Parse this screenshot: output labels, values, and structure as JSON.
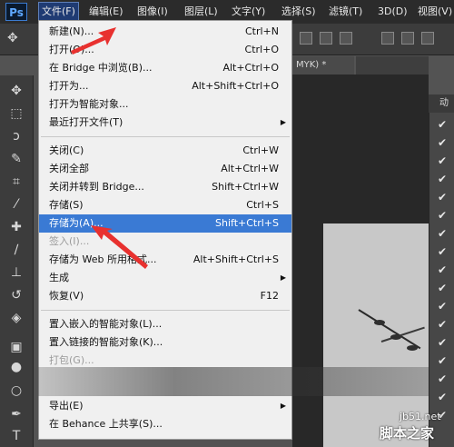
{
  "app": {
    "logo": "Ps"
  },
  "menubar": {
    "items": [
      {
        "label": "文件(F)",
        "active": true
      },
      {
        "label": "编辑(E)"
      },
      {
        "label": "图像(I)"
      },
      {
        "label": "图层(L)"
      },
      {
        "label": "文字(Y)"
      },
      {
        "label": "选择(S)"
      },
      {
        "label": "滤镜(T)"
      },
      {
        "label": "3D(D)"
      },
      {
        "label": "视图(V)"
      }
    ]
  },
  "document": {
    "tab_label": "MYK) *"
  },
  "panel": {
    "header": "动"
  },
  "file_menu": {
    "items": [
      {
        "label": "新建(N)...",
        "shortcut": "Ctrl+N"
      },
      {
        "label": "打开(O)...",
        "shortcut": "Ctrl+O"
      },
      {
        "label": "在 Bridge 中浏览(B)...",
        "shortcut": "Alt+Ctrl+O"
      },
      {
        "label": "打开为...",
        "shortcut": "Alt+Shift+Ctrl+O"
      },
      {
        "label": "打开为智能对象...",
        "shortcut": ""
      },
      {
        "label": "最近打开文件(T)",
        "shortcut": "",
        "submenu": true
      },
      {
        "label": "关闭(C)",
        "shortcut": "Ctrl+W"
      },
      {
        "label": "关闭全部",
        "shortcut": "Alt+Ctrl+W"
      },
      {
        "label": "关闭并转到 Bridge...",
        "shortcut": "Shift+Ctrl+W"
      },
      {
        "label": "存储(S)",
        "shortcut": "Ctrl+S"
      },
      {
        "label": "存储为(A)...",
        "shortcut": "Shift+Ctrl+S",
        "highlighted": true
      },
      {
        "label": "签入(I)...",
        "shortcut": "",
        "disabled": true
      },
      {
        "label": "存储为 Web 所用格式...",
        "shortcut": "Alt+Shift+Ctrl+S"
      },
      {
        "label": "生成",
        "shortcut": "",
        "submenu": true
      },
      {
        "label": "恢复(V)",
        "shortcut": "F12"
      },
      {
        "label": "置入嵌入的智能对象(L)...",
        "shortcut": ""
      },
      {
        "label": "置入链接的智能对象(K)...",
        "shortcut": ""
      },
      {
        "label": "打包(G)...",
        "shortcut": "",
        "disabled": true
      },
      {
        "label": "导出(E)",
        "shortcut": "",
        "submenu": true
      },
      {
        "label": "在 Behance 上共享(S)...",
        "shortcut": ""
      }
    ]
  },
  "watermark": {
    "site": "jb51.net",
    "name": "脚本之家"
  },
  "icons": {
    "toolbar": [
      "move-icon",
      "marquee-icon",
      "lasso-icon",
      "quick-select-icon",
      "crop-icon",
      "eyedropper-icon",
      "healing-brush-icon",
      "brush-icon",
      "clone-stamp-icon",
      "history-brush-icon",
      "eraser-icon",
      "gradient-icon",
      "blur-icon",
      "dodge-icon",
      "pen-icon",
      "type-icon"
    ],
    "colors": {
      "highlight": "#3a7ad4",
      "menu_active": "#1f3b73",
      "arrow": "#e8312f"
    }
  }
}
